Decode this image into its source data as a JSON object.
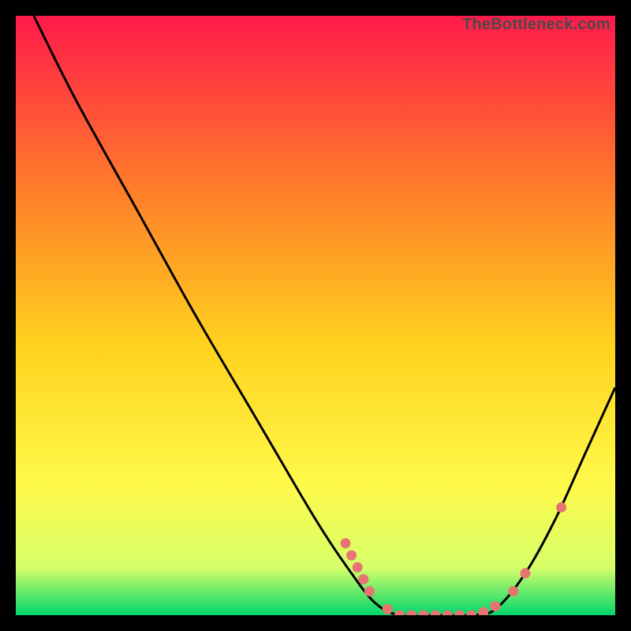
{
  "watermark": "TheBottleneck.com",
  "chart_data": {
    "type": "line",
    "title": "",
    "xlabel": "",
    "ylabel": "",
    "xlim": [
      0,
      100
    ],
    "ylim": [
      0,
      100
    ],
    "gradient_colors": {
      "top": "#ff1a4b",
      "upper_mid": "#ff7a2a",
      "mid": "#ffd21e",
      "lower_mid": "#fff94a",
      "low": "#d7ff69",
      "bottom": "#00d66b"
    },
    "curve": [
      {
        "x": 3,
        "y": 100
      },
      {
        "x": 10,
        "y": 86
      },
      {
        "x": 20,
        "y": 68
      },
      {
        "x": 30,
        "y": 50
      },
      {
        "x": 40,
        "y": 33
      },
      {
        "x": 50,
        "y": 16
      },
      {
        "x": 56,
        "y": 7
      },
      {
        "x": 60,
        "y": 2
      },
      {
        "x": 64,
        "y": 0
      },
      {
        "x": 70,
        "y": 0
      },
      {
        "x": 76,
        "y": 0
      },
      {
        "x": 80,
        "y": 1
      },
      {
        "x": 85,
        "y": 7
      },
      {
        "x": 90,
        "y": 16
      },
      {
        "x": 95,
        "y": 27
      },
      {
        "x": 100,
        "y": 38
      }
    ],
    "markers": [
      {
        "x": 55,
        "y": 12
      },
      {
        "x": 56,
        "y": 10
      },
      {
        "x": 57,
        "y": 8
      },
      {
        "x": 58,
        "y": 6
      },
      {
        "x": 59,
        "y": 4
      },
      {
        "x": 62,
        "y": 1
      },
      {
        "x": 64,
        "y": 0
      },
      {
        "x": 66,
        "y": 0
      },
      {
        "x": 68,
        "y": 0
      },
      {
        "x": 70,
        "y": 0
      },
      {
        "x": 72,
        "y": 0
      },
      {
        "x": 74,
        "y": 0
      },
      {
        "x": 76,
        "y": 0
      },
      {
        "x": 78,
        "y": 0.5
      },
      {
        "x": 80,
        "y": 1.5
      },
      {
        "x": 83,
        "y": 4
      },
      {
        "x": 85,
        "y": 7
      },
      {
        "x": 91,
        "y": 18
      }
    ],
    "marker_color": "#e77471",
    "curve_color": "#000000"
  }
}
